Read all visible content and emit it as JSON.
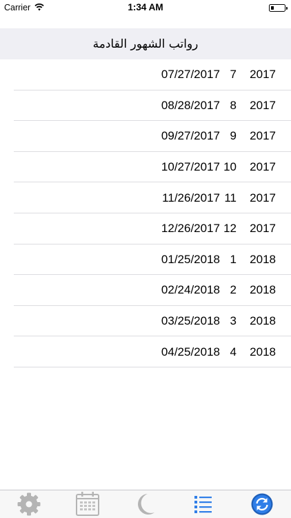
{
  "status_bar": {
    "carrier": "Carrier",
    "time": "1:34 AM"
  },
  "header": {
    "title": "رواتب الشهور القادمة"
  },
  "rows": [
    {
      "date": "07/27/2017",
      "month": "7",
      "year": "2017"
    },
    {
      "date": "08/28/2017",
      "month": "8",
      "year": "2017"
    },
    {
      "date": "09/27/2017",
      "month": "9",
      "year": "2017"
    },
    {
      "date": "10/27/2017",
      "month": "10",
      "year": "2017"
    },
    {
      "date": "11/26/2017",
      "month": "11",
      "year": "2017"
    },
    {
      "date": "12/26/2017",
      "month": "12",
      "year": "2017"
    },
    {
      "date": "01/25/2018",
      "month": "1",
      "year": "2018"
    },
    {
      "date": "02/24/2018",
      "month": "2",
      "year": "2018"
    },
    {
      "date": "03/25/2018",
      "month": "3",
      "year": "2018"
    },
    {
      "date": "04/25/2018",
      "month": "4",
      "year": "2018"
    }
  ],
  "tab_bar": {
    "tabs": [
      {
        "icon": "gear-icon",
        "active": false
      },
      {
        "icon": "calendar-icon",
        "active": false
      },
      {
        "icon": "moon-icon",
        "active": false
      },
      {
        "icon": "list-icon",
        "active": true
      },
      {
        "icon": "refresh-icon",
        "active": false
      }
    ],
    "active_color": "#2f7ee8",
    "inactive_color": "#b4b4b4"
  }
}
